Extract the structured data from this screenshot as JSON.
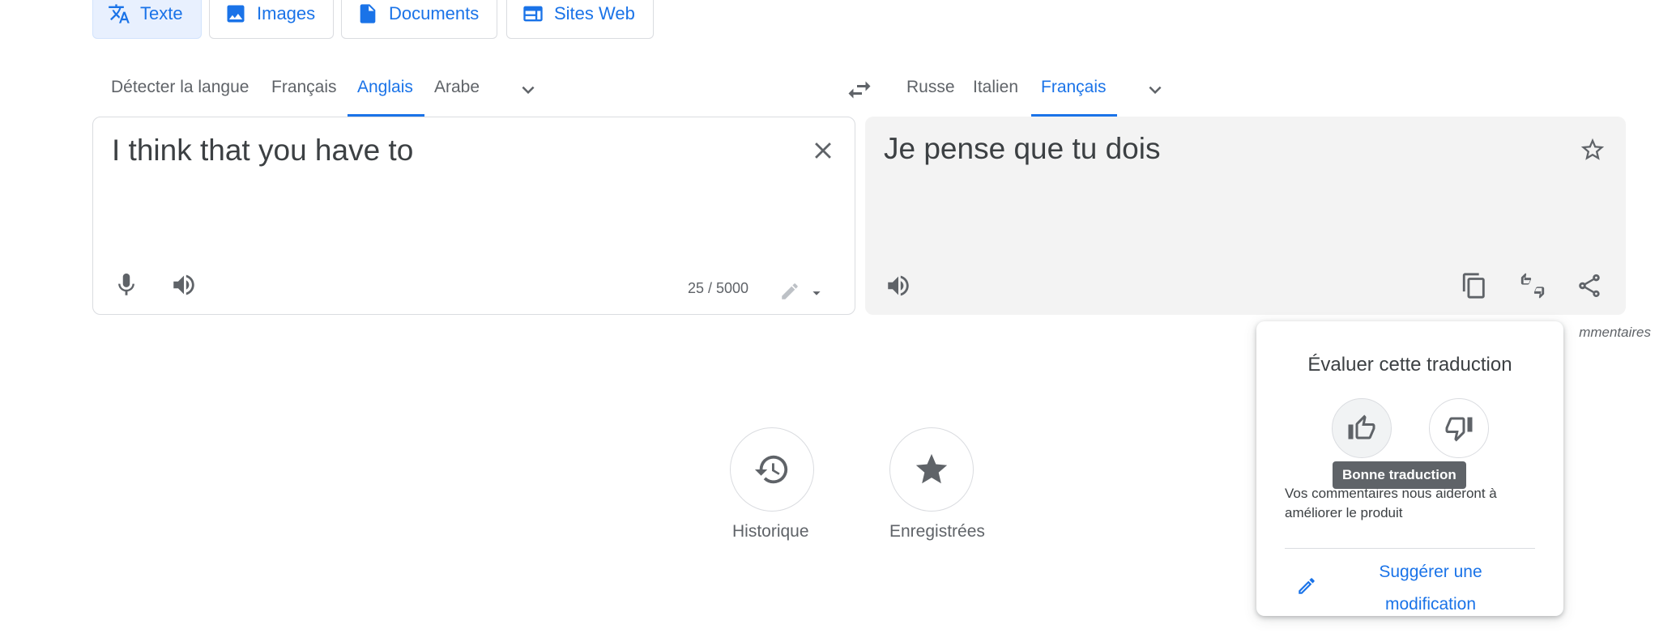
{
  "tabs": [
    {
      "label": "Texte",
      "icon": "translate-icon",
      "active": true
    },
    {
      "label": "Images",
      "icon": "image-icon",
      "active": false
    },
    {
      "label": "Documents",
      "icon": "document-icon",
      "active": false
    },
    {
      "label": "Sites Web",
      "icon": "web-icon",
      "active": false
    }
  ],
  "source_langs": [
    "Détecter la langue",
    "Français",
    "Anglais",
    "Arabe"
  ],
  "source_active": "Anglais",
  "target_langs": [
    "Russe",
    "Italien",
    "Français"
  ],
  "target_active": "Français",
  "source": {
    "text": "I think that you have to",
    "counter": "25 / 5000"
  },
  "target": {
    "text": "Je pense que tu dois"
  },
  "bottom": {
    "history_label": "Historique",
    "saved_label": "Enregistrées"
  },
  "feedback_link": "mmentaires",
  "popup": {
    "title": "Évaluer cette traduction",
    "tooltip": "Bonne traduction",
    "desc": "Vos commentaires nous aideront à améliorer le produit",
    "suggest": "Suggérer une modification"
  },
  "colors": {
    "accent": "#1a73e8",
    "target_bg": "#f3f3f3",
    "tooltip_bg": "#5f6368"
  }
}
